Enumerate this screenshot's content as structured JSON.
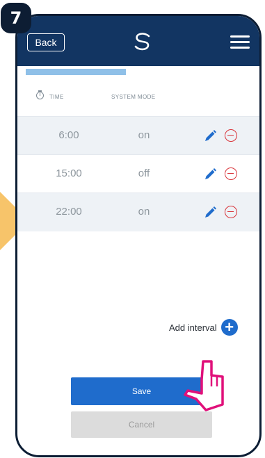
{
  "step": {
    "number": "7"
  },
  "header": {
    "back_label": "Back",
    "logo_icon": "brand-swirl-icon",
    "menu_icon": "hamburger-menu-icon",
    "color": "#123562"
  },
  "schedule": {
    "col_time": "TIME",
    "col_mode": "SYSTEM MODE",
    "rows": [
      {
        "time": "6:00",
        "mode": "on"
      },
      {
        "time": "15:00",
        "mode": "off"
      },
      {
        "time": "22:00",
        "mode": "on"
      }
    ]
  },
  "actions": {
    "add_interval_label": "Add interval",
    "save_label": "Save",
    "cancel_label": "Cancel"
  },
  "colors": {
    "accent": "#1f6ccc",
    "remove": "#d9343a",
    "pointer_outline": "#e0107a",
    "arrow": "#f7c46a"
  }
}
